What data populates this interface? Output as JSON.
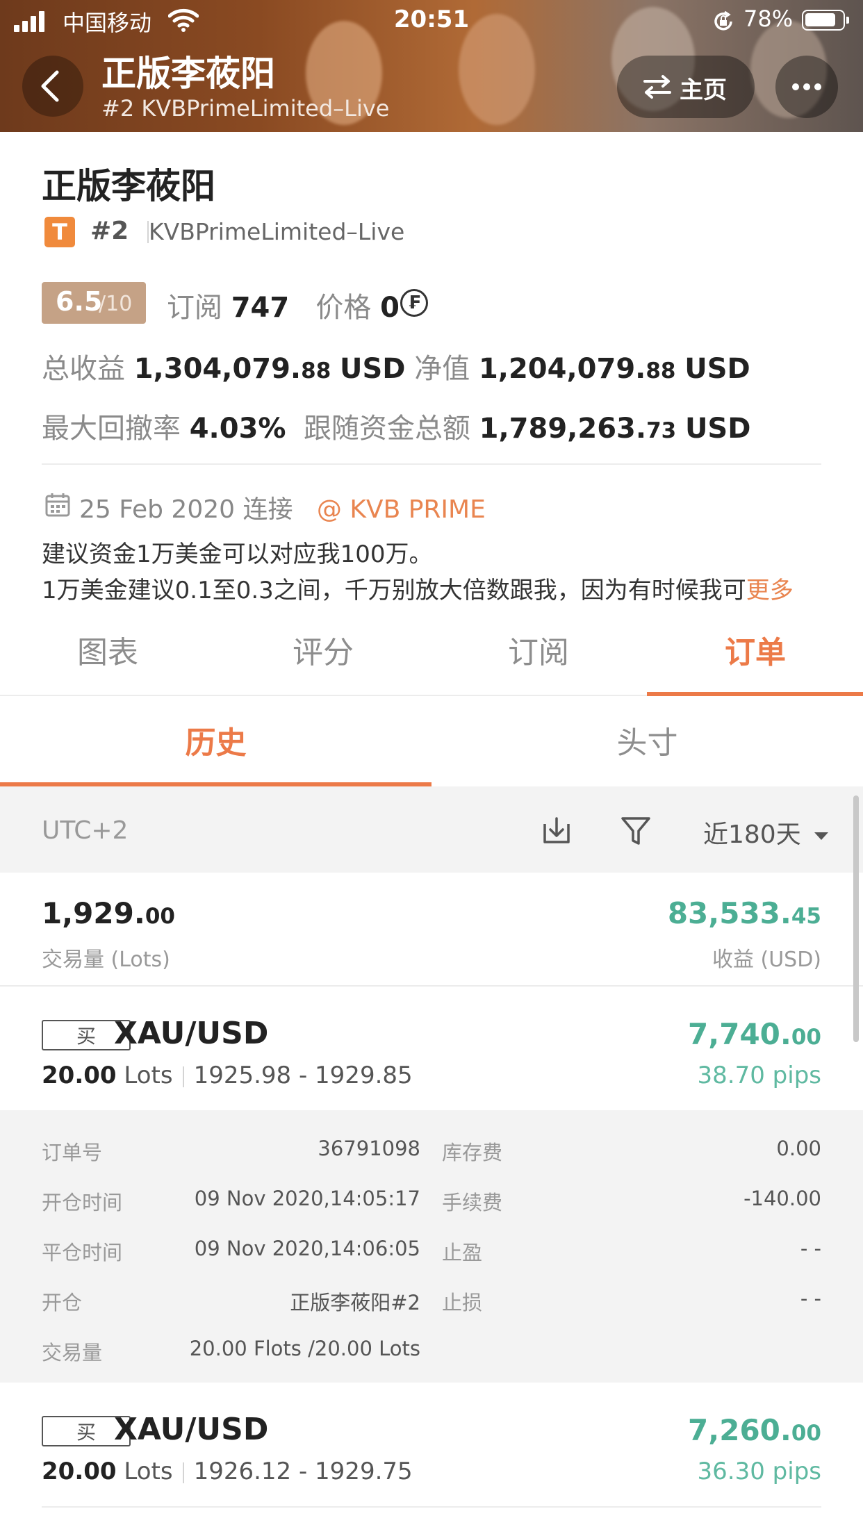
{
  "status_bar": {
    "carrier": "中国移动",
    "time": "20:51",
    "battery": "78%"
  },
  "header": {
    "title": "正版李莜阳",
    "subtitle": "#2 KVBPrimeLimited–Live",
    "home_label": "主页"
  },
  "profile": {
    "name": "正版李莜阳",
    "badge": "T",
    "account_number": "#2",
    "account_name": "KVBPrimeLimited–Live",
    "rating": "6.5",
    "rating_max": "/10",
    "subscribe_label": "订阅",
    "subscribe_count": "747",
    "price_label": "价格",
    "price_value": "0",
    "price_icon": "₣",
    "total_profit_label": "总收益",
    "total_profit_main": "1,304,079.",
    "total_profit_cents": "88",
    "total_profit_unit": "USD",
    "net_value_label": "净值",
    "net_value_main": "1,204,079.",
    "net_value_cents": "88",
    "net_value_unit": "USD",
    "max_drawdown_label": "最大回撤率",
    "max_drawdown_value": "4.03%",
    "follow_fund_label": "跟随资金总额",
    "follow_fund_main": "1,789,263.",
    "follow_fund_cents": "73",
    "follow_fund_unit": "USD",
    "connected_date": "25 Feb 2020",
    "connected_label": "连接",
    "broker_at": "@",
    "broker_name": "KVB PRIME",
    "description_line1": "建议资金1万美金可以对应我100万。",
    "description_line2": "1万美金建议0.1至0.3之间，千万别放大倍数跟我，因为有时候我可",
    "more_label": "更多"
  },
  "tabs": [
    "图表",
    "评分",
    "订阅",
    "订单"
  ],
  "subtabs": [
    "历史",
    "头寸"
  ],
  "filter": {
    "timezone": "UTC+2",
    "range": "近180天"
  },
  "summary": {
    "lots_main": "1,929.",
    "lots_cents": "00",
    "lots_label": "交易量 (Lots)",
    "profit_main": "83,533.",
    "profit_cents": "45",
    "profit_label": "收益 (USD)"
  },
  "orders": [
    {
      "side": "买",
      "symbol": "XAU/USD",
      "lots": "20.00",
      "lots_unit": "Lots",
      "price_range": "1925.98 - 1929.85",
      "profit_main": "7,740.",
      "profit_cents": "00",
      "pips": "38.70 pips",
      "details": {
        "order_no_label": "订单号",
        "order_no": "36791098",
        "swap_label": "库存费",
        "swap": "0.00",
        "open_time_label": "开仓时间",
        "open_time": "09 Nov 2020,14:05:17",
        "fee_label": "手续费",
        "fee": "-140.00",
        "close_time_label": "平仓时间",
        "close_time": "09 Nov 2020,14:06:05",
        "tp_label": "止盈",
        "tp": "- -",
        "open_label": "开仓",
        "open_account": "正版李莜阳#2",
        "sl_label": "止损",
        "sl": "- -",
        "volume_label": "交易量",
        "volume": "20.00 Flots /20.00 Lots"
      }
    },
    {
      "side": "买",
      "symbol": "XAU/USD",
      "lots": "20.00",
      "lots_unit": "Lots",
      "price_range": "1926.12 - 1929.75",
      "profit_main": "7,260.",
      "profit_cents": "00",
      "pips": "36.30 pips"
    }
  ],
  "colors": {
    "accent": "#ec7a48",
    "profit": "#4cae94",
    "rating_bg": "#c5a286",
    "badge": "#f08a3c"
  }
}
